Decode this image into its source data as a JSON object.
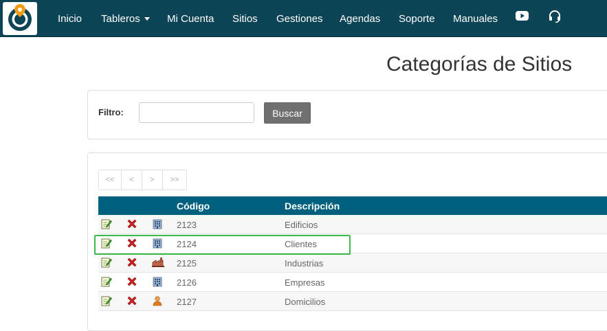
{
  "nav": {
    "items": [
      {
        "label": "Inicio"
      },
      {
        "label": "Tableros"
      },
      {
        "label": "Mi Cuenta"
      },
      {
        "label": "Sitios"
      },
      {
        "label": "Gestiones"
      },
      {
        "label": "Agendas"
      },
      {
        "label": "Soporte"
      },
      {
        "label": "Manuales"
      }
    ],
    "icons": [
      "youtube-icon",
      "headset-icon"
    ]
  },
  "page": {
    "title": "Categorías de Sitios"
  },
  "filter": {
    "label": "Filtro:",
    "value": "",
    "button": "Buscar"
  },
  "pager": {
    "first": "<<",
    "prev": "<",
    "next": ">",
    "last": ">>"
  },
  "table": {
    "headers": {
      "code": "Código",
      "description": "Descripción"
    },
    "rows": [
      {
        "code": "2123",
        "description": "Edificios",
        "icon": "building-icon"
      },
      {
        "code": "2124",
        "description": "Clientes",
        "icon": "building-icon"
      },
      {
        "code": "2125",
        "description": "Industrias",
        "icon": "factory-icon"
      },
      {
        "code": "2126",
        "description": "Empresas",
        "icon": "building-icon"
      },
      {
        "code": "2127",
        "description": "Domicilios",
        "icon": "person-icon"
      }
    ],
    "highlighted_row": "2124"
  },
  "colors": {
    "navbar": "#0d4557",
    "table_header": "#00607d",
    "highlight": "#3dbb4a",
    "delete": "#cc2222"
  }
}
